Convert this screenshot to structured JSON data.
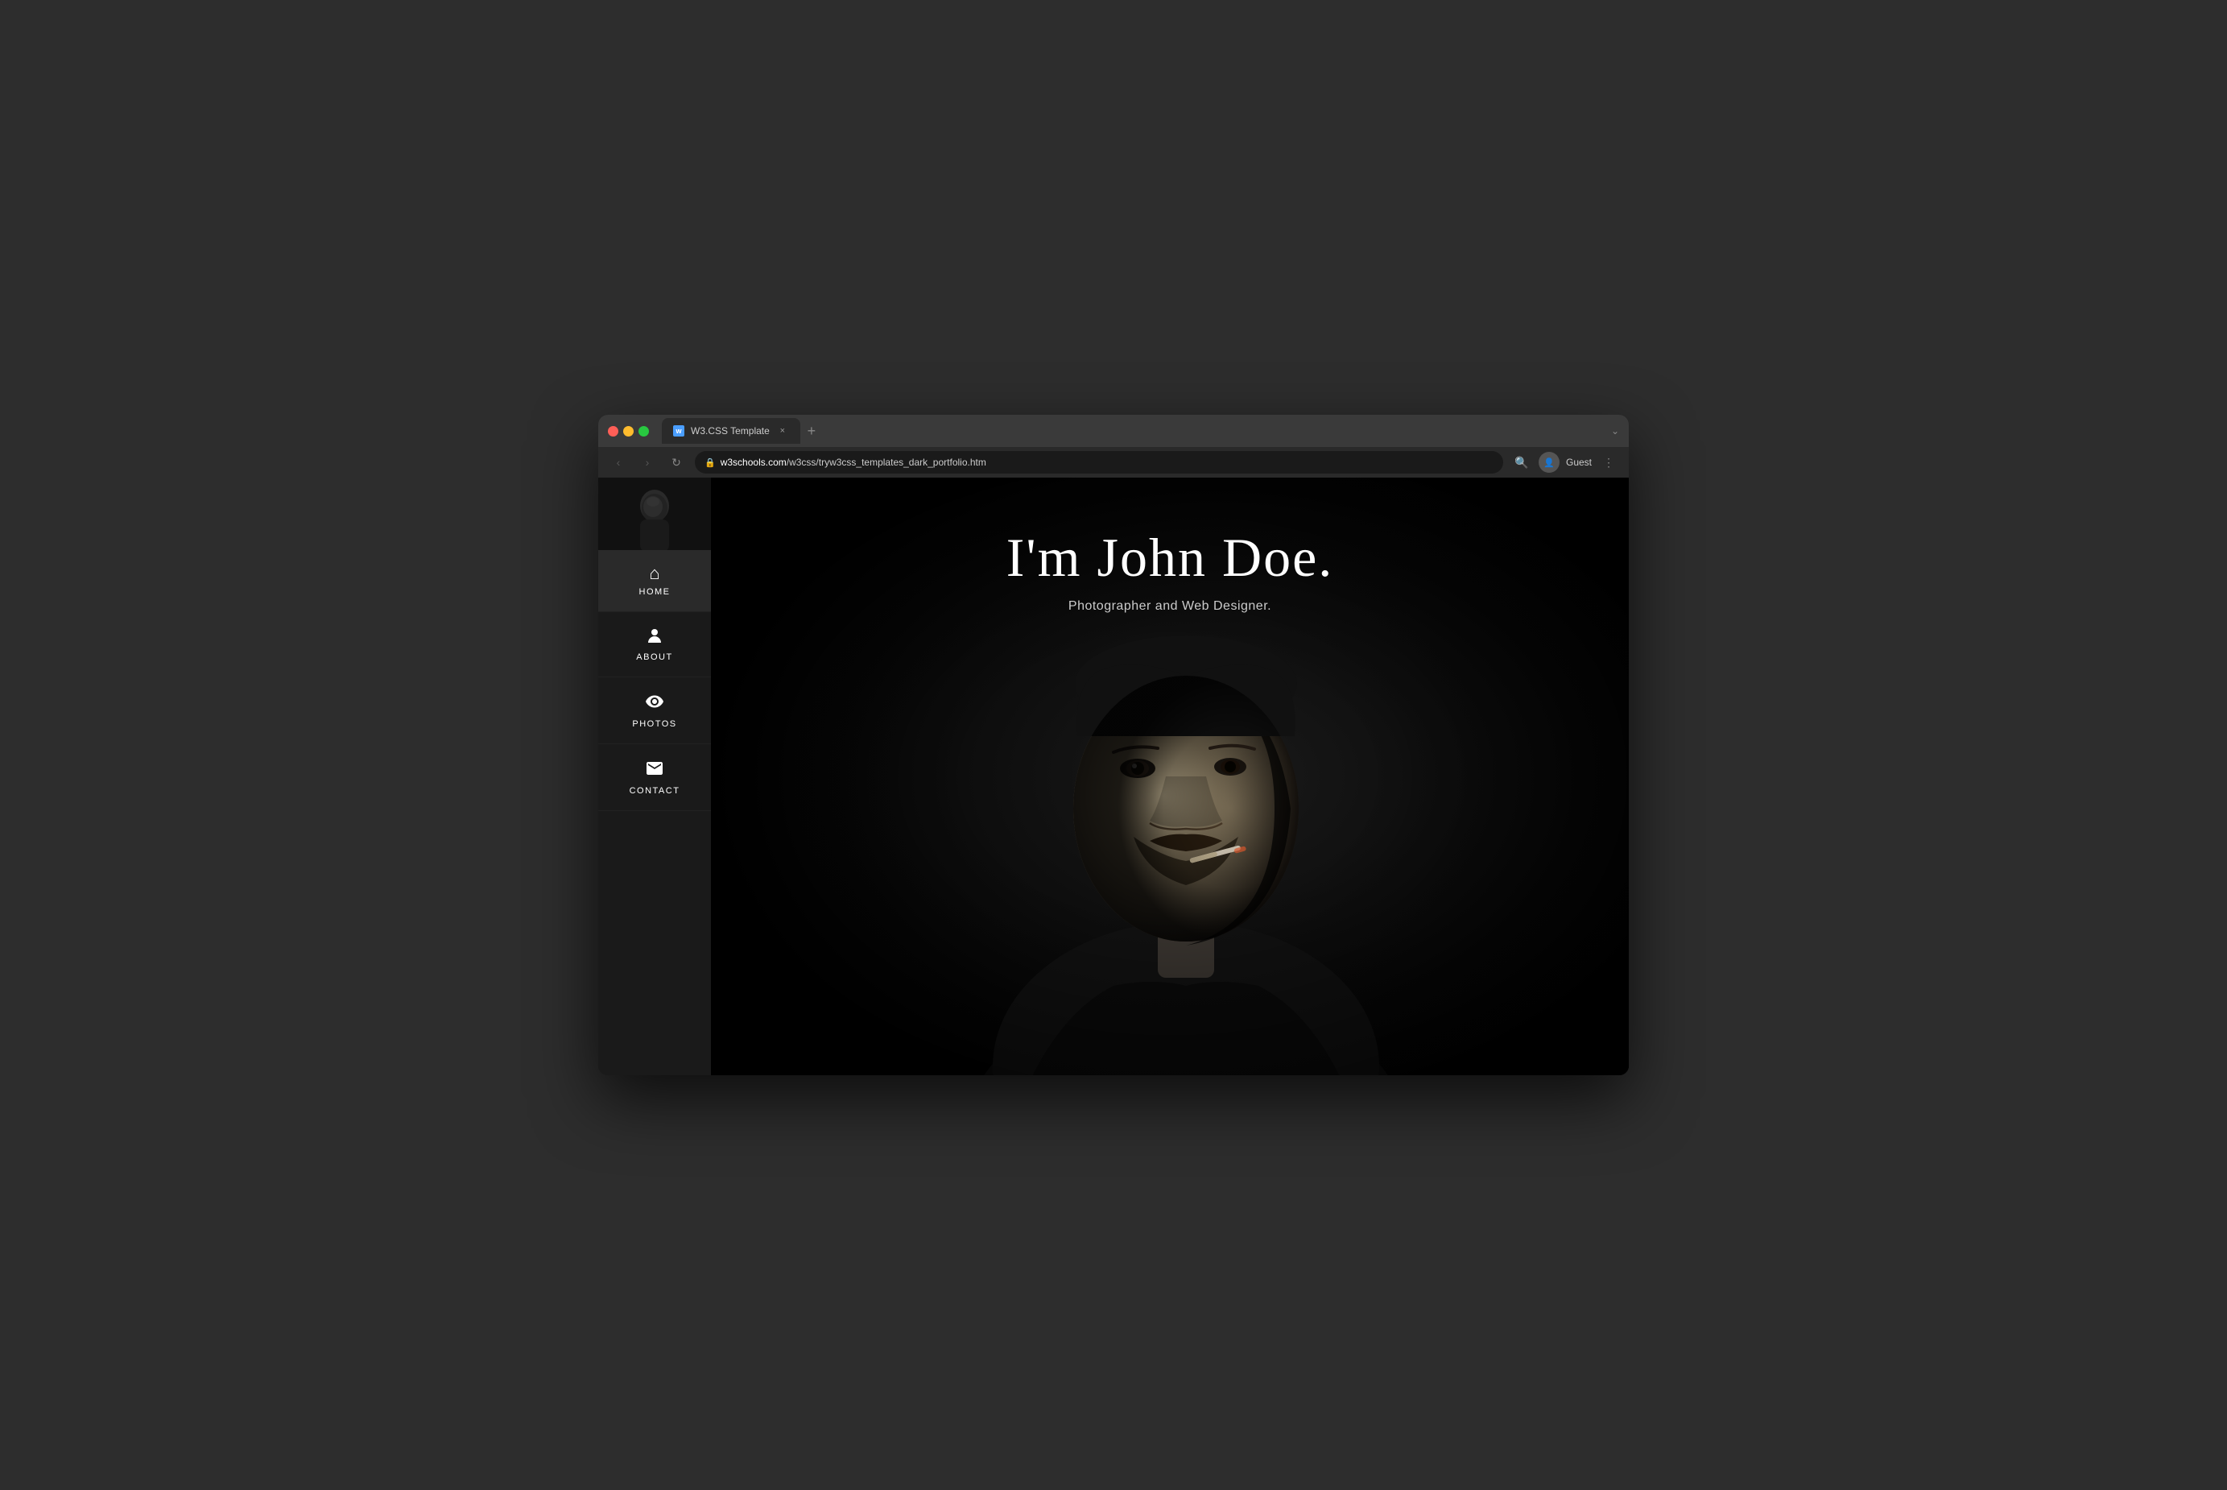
{
  "browser": {
    "title": "W3.CSS Template",
    "url_prefix": "w3schools.com",
    "url_path": "/w3css/tryw3css_templates_dark_portfolio.htm",
    "url_full": "w3schools.com/w3css/tryw3css_templates_dark_portfolio.htm",
    "tab_label": "W3.CSS Template",
    "new_tab_label": "+",
    "back_button": "‹",
    "forward_button": "›",
    "refresh_icon": "↻",
    "search_icon": "🔍",
    "user_label": "Guest",
    "more_icon": "⋮"
  },
  "sidebar": {
    "nav_items": [
      {
        "id": "home",
        "label": "HOME",
        "icon": "⌂",
        "active": true
      },
      {
        "id": "about",
        "label": "ABOUT",
        "icon": "👤",
        "active": false
      },
      {
        "id": "photos",
        "label": "PHOTOS",
        "icon": "👁",
        "active": false
      },
      {
        "id": "contact",
        "label": "CONTACT",
        "icon": "✉",
        "active": false
      }
    ]
  },
  "hero": {
    "title": "I'm John Doe.",
    "subtitle": "Photographer and Web Designer."
  },
  "colors": {
    "sidebar_bg": "#1a1a1a",
    "sidebar_active": "#2a2a2a",
    "main_bg": "#000000",
    "text_primary": "#ffffff",
    "text_secondary": "#cccccc"
  }
}
